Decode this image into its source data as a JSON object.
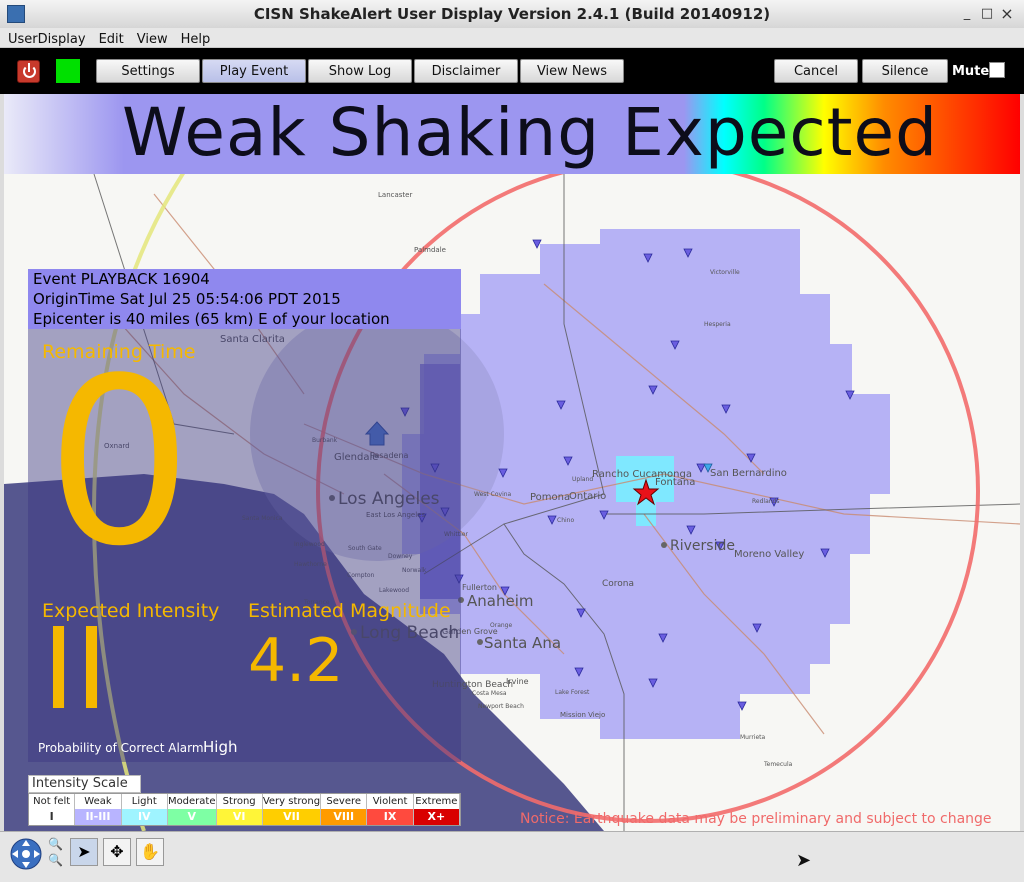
{
  "window": {
    "title": "CISN ShakeAlert User Display Version 2.4.1 (Build 20140912)",
    "min_glyph": "_",
    "max_glyph": "□",
    "close_glyph": "×"
  },
  "menu": {
    "items": [
      "UserDisplay",
      "Edit",
      "View",
      "Help"
    ]
  },
  "toolbar": {
    "settings": "Settings",
    "play_event": "Play Event",
    "show_log": "Show Log",
    "disclaimer": "Disclaimer",
    "view_news": "View News",
    "cancel": "Cancel",
    "silence": "Silence",
    "mute": "Mute",
    "status_color": "#00e000"
  },
  "banner": {
    "text": "Weak Shaking Expected"
  },
  "event": {
    "line1": "Event PLAYBACK 16904",
    "line2": "OriginTime Sat Jul 25 05:54:06 PDT 2015",
    "line3": "Epicenter is 40 miles (65 km) E of your location"
  },
  "panel": {
    "remaining_label": "Remaining Time",
    "remaining_value": "0",
    "intensity_label": "Expected Intensity",
    "intensity_value": "II",
    "magnitude_label": "Estimated Magnitude",
    "magnitude_value": "4.2",
    "prob_label": "Probability of Correct Alarm",
    "prob_value": "High"
  },
  "scale": {
    "title": "Intensity Scale",
    "items": [
      {
        "name": "Not felt",
        "roman": "I",
        "color": "#ffffff"
      },
      {
        "name": "Weak",
        "roman": "II-III",
        "color": "#b8b4ff"
      },
      {
        "name": "Light",
        "roman": "IV",
        "color": "#9ff4ff"
      },
      {
        "name": "Moderate",
        "roman": "V",
        "color": "#7effa4"
      },
      {
        "name": "Strong",
        "roman": "VI",
        "color": "#fff538"
      },
      {
        "name": "Very strong",
        "roman": "VII",
        "color": "#ffce00"
      },
      {
        "name": "Severe",
        "roman": "VIII",
        "color": "#ff9b00"
      },
      {
        "name": "Violent",
        "roman": "IX",
        "color": "#ff4a3e"
      },
      {
        "name": "Extreme",
        "roman": "X+",
        "color": "#d90000"
      }
    ]
  },
  "notice": "Notice: Earthquake data may be preliminary and subject to change",
  "map": {
    "cities_large": [
      "Los Angeles",
      "Long Beach",
      "Anaheim",
      "Santa Ana",
      "Riverside"
    ],
    "cities_medium": [
      "Santa Clarita",
      "Glendale",
      "Pasadena",
      "Pomona",
      "Ontario",
      "Rancho Cucamonga",
      "Fontana",
      "San Bernardino",
      "Moreno Valley",
      "Corona",
      "Fullerton",
      "Garden Grove",
      "Irvine",
      "Huntington Beach"
    ],
    "cities_small": [
      "Lancaster",
      "Palmdale",
      "Victorville",
      "Hesperia",
      "Oxnard",
      "Burbank",
      "Santa Monica",
      "Inglewood",
      "Torrance",
      "Compton",
      "Norwalk",
      "Downey",
      "Whittier",
      "West Covina",
      "Upland",
      "Chino",
      "Redlands",
      "Orange",
      "Costa Mesa",
      "Newport Beach",
      "Lake Forest",
      "Mission Viejo",
      "Murrieta",
      "Temecula",
      "East Los Angeles",
      "South Gate",
      "Lakewood",
      "Hawthorne"
    ]
  }
}
